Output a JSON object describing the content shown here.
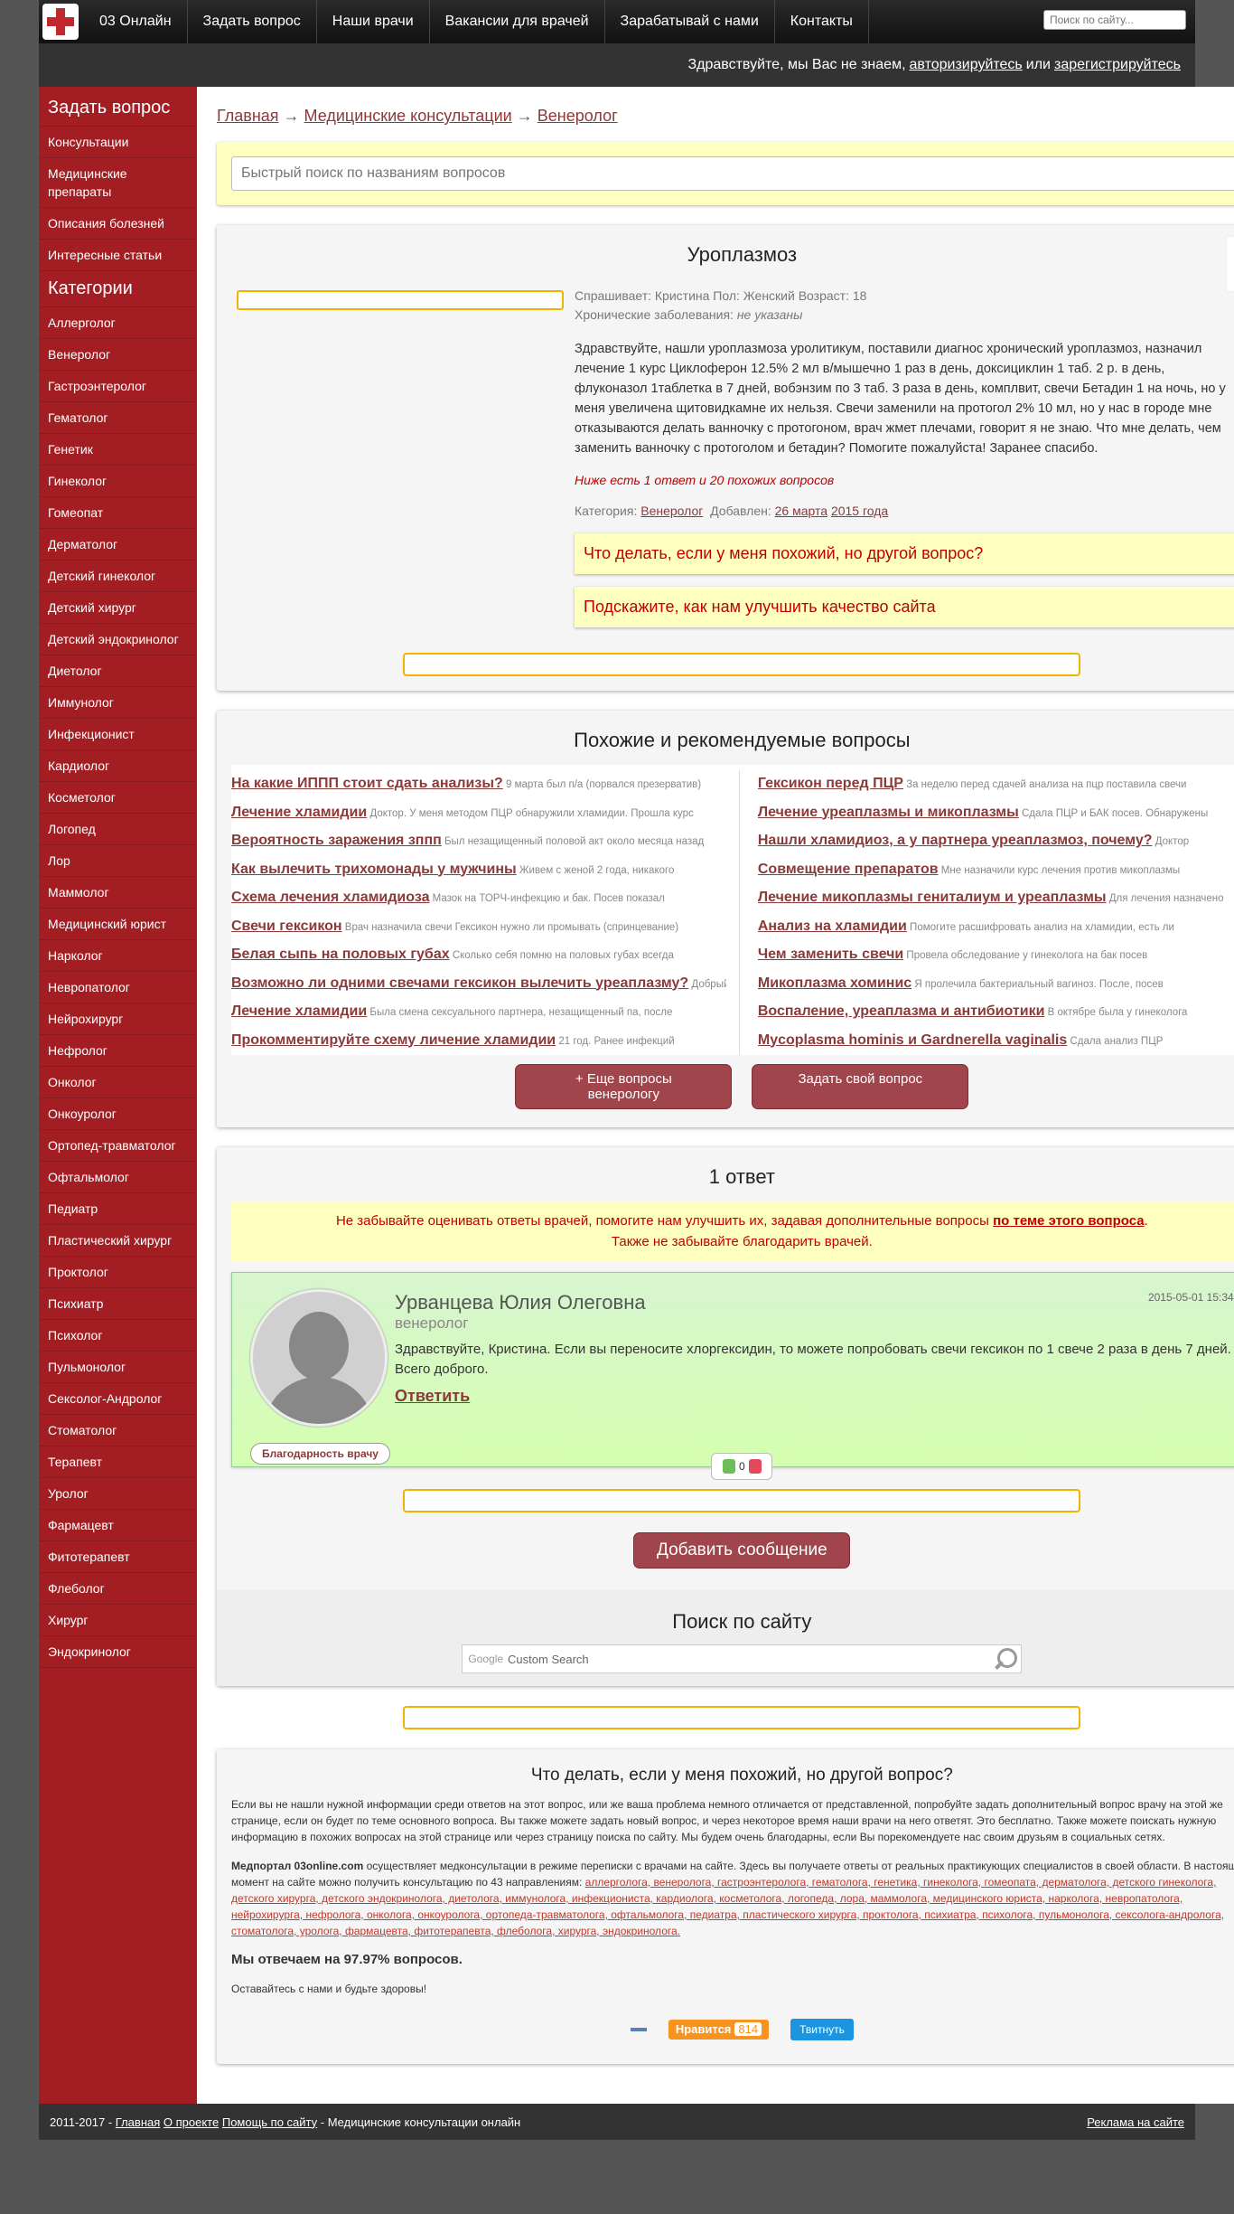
{
  "topnav": {
    "items": [
      "03 Онлайн",
      "Задать вопрос",
      "Наши врачи",
      "Вакансии для врачей",
      "Зарабатывай с нами",
      "Контакты"
    ],
    "search_placeholder": "Поиск по сайту..."
  },
  "greeting": {
    "text": "Здравствуйте, мы Вас не знаем,",
    "login": "авторизируйтесь",
    "or": "или",
    "register": "зарегистрируйтесь"
  },
  "sidebar": {
    "ask_heading": "Задать вопрос",
    "ask_items": [
      "Консультации",
      "Медицинские препараты",
      "Описания болезней",
      "Интересные статьи"
    ],
    "cat_heading": "Категории",
    "categories": [
      "Аллерголог",
      "Венеролог",
      "Гастроэнтеролог",
      "Гематолог",
      "Генетик",
      "Гинеколог",
      "Гомеопат",
      "Дерматолог",
      "Детский гинеколог",
      "Детский хирург",
      "Детский эндокринолог",
      "Диетолог",
      "Иммунолог",
      "Инфекционист",
      "Кардиолог",
      "Косметолог",
      "Логопед",
      "Лор",
      "Маммолог",
      "Медицинский юрист",
      "Нарколог",
      "Невропатолог",
      "Нейрохирург",
      "Нефролог",
      "Онколог",
      "Онкоуролог",
      "Ортопед-травматолог",
      "Офтальмолог",
      "Педиатр",
      "Пластический хирург",
      "Проктолог",
      "Психиатр",
      "Психолог",
      "Пульмонолог",
      "Сексолог-Андролог",
      "Стоматолог",
      "Терапевт",
      "Уролог",
      "Фармацевт",
      "Фитотерапевт",
      "Флеболог",
      "Хирург",
      "Эндокринолог"
    ]
  },
  "breadcrumbs": {
    "home": "Главная",
    "arrow": "→",
    "consult": "Медицинские консультации",
    "current": "Венеролог"
  },
  "quick_search": {
    "placeholder": "Быстрый поиск по названиям вопросов"
  },
  "question": {
    "title": "Уроплазмоз",
    "asker_line": "Спрашивает: Кристина   Пол: Женский   Возраст: 18",
    "chronic_label": "Хронические заболевания:",
    "chronic_value": "не указаны",
    "text": "Здравствуйте, нашли уроплазмоза уролитикум, поставили диагнос хронический уроплазмоз, назначил лечение 1 курс Циклоферон 12.5% 2 мл в/мышечно 1 раз в день, доксициклин 1 таб. 2 р. в день, флуконазол 1таблетка в 7 дней, вобэнзим по 3 таб. 3 раза в день, комплвит, свечи Бетадин 1 на ночь, но у меня увеличена щитовидкамне их нельзя. Свечи заменили на протогол 2% 10 мл, но у нас в городе мне отказываются делать ванночку с протогоном, врач жмет плечами, говорит я не знаю. Что мне делать, чем заменить ванночку с протоголом и бетадин? Помогите пожалуйста! Заранее спасибо.",
    "below_note": "Ниже есть 1 ответ и 20 похожих вопросов",
    "category_label": "Категория:",
    "category": "Венеролог",
    "added_label": "Добавлен:",
    "added_day": "26 марта",
    "added_year": "2015 года",
    "link1": "Что делать, если у меня похожий, но другой вопрос?",
    "link2": "Подскажите, как нам улучшить качество сайта",
    "votes": "0"
  },
  "similar": {
    "title": "Похожие и рекомендуемые вопросы",
    "left": [
      {
        "t": "На какие ИППП стоит сдать анализы?",
        "s": "9 марта был п/а (порвался презерватив)"
      },
      {
        "t": "Лечение хламидии",
        "s": "Доктор. У меня методом ПЦР обнаружили хламидии. Прошла курс"
      },
      {
        "t": "Вероятность заражения зппп",
        "s": "Был незащищенный половой акт около месяца назад"
      },
      {
        "t": "Как вылечить трихомонады у мужчины",
        "s": "Живем с женой 2 года, никакого"
      },
      {
        "t": "Схема лечения хламидиоза",
        "s": "Мазок на ТОРЧ-инфекцию и бак. Посев показал"
      },
      {
        "t": "Свечи гексикон",
        "s": "Врач назначила свечи Гексикон нужно ли промывать (спринцевание)"
      },
      {
        "t": "Белая сыпь на половых губах",
        "s": "Сколько себя помню на половых губах всегда"
      },
      {
        "t": "Возможно ли одними свечами гексикон вылечить уреаплазму?",
        "s": "Добрый день"
      },
      {
        "t": "Лечение хламидии",
        "s": "Была смена сексуального партнера, незащищенный па, после"
      },
      {
        "t": "Прокомментируйте схему личение хламидии",
        "s": "21 год. Ранее инфекций"
      }
    ],
    "right": [
      {
        "t": "Гексикон перед ПЦР",
        "s": "За неделю перед сдачей анализа на пцр поставила свечи"
      },
      {
        "t": "Лечение уреаплазмы и микоплазмы",
        "s": "Сдала ПЦР и БАК посев. Обнаружены"
      },
      {
        "t": "Нашли хламидиоз, а у партнера уреаплазмоз, почему?",
        "s": "Доктор"
      },
      {
        "t": "Совмещение препаратов",
        "s": "Мне назначили курс лечения против микоплазмы"
      },
      {
        "t": "Лечение микоплазмы гениталиум и уреаплазмы",
        "s": "Для лечения назначено"
      },
      {
        "t": "Анализ на хламидии",
        "s": "Помогите расшифровать анализ на хламидии, есть ли"
      },
      {
        "t": "Чем заменить свечи",
        "s": "Провела обследование у гинеколога на бак посев"
      },
      {
        "t": "Микоплазма хоминис",
        "s": "Я пролечила бактериальный вагиноз. После, посев"
      },
      {
        "t": "Воспаление, уреаплазма и антибиотики",
        "s": "В октябре была у гинеколога"
      },
      {
        "t": "Mycoplasma hominis и Gardnerella vaginalis",
        "s": "Сдала анализ ПЦР"
      }
    ],
    "more_btn": "+ Еще вопросы венерологу",
    "ask_btn": "Задать свой вопрос"
  },
  "answers": {
    "title": "1 ответ",
    "notice_1": "Не забывайте оценивать ответы врачей, помогите нам улучшить их, задавая дополнительные вопросы",
    "notice_link": "по теме этого вопроса",
    "notice_2": "Также не забывайте благодарить врачей.",
    "doctor_name": "Урванцева Юлия Олеговна",
    "doctor_spec": "венеролог",
    "date": "2015-05-01 15:34",
    "text": "Здравствуйте, Кристина. Если вы переносите хлоргексидин, то можете попробовать свечи гексикон по 1 свече 2 раза в день 7 дней. Всего доброго.",
    "reply": "Ответить",
    "thanks": "Благодарность врачу",
    "likes": "0",
    "add_message": "Добавить сообщение"
  },
  "site_search": {
    "title": "Поиск по сайту",
    "google": "Google",
    "custom": "Custom Search"
  },
  "info": {
    "title": "Что делать, если у меня похожий, но другой вопрос?",
    "p1": "Если вы не нашли нужной информации среди ответов на этот вопрос, или же ваша проблема немного отличается от представленной, попробуйте задать дополнительный вопрос врачу на этой же странице, если он будет по теме основного вопроса. Вы также можете задать новый вопрос, и через некоторое время наши врачи на него ответят. Это бесплатно. Также можете поискать нужную информацию в похожих вопросах на этой странице или через страницу поиска по сайту. Мы будем очень благодарны, если Вы порекомендуете нас своим друзьям в социальных сетях.",
    "p2_lead": "Медпортал 03online.com",
    "p2_text": "осуществляет медконсультации в режиме переписки с врачами на сайте. Здесь вы получаете ответы от реальных практикующих специалистов в своей области. В настоящий момент на сайте можно получить консультацию по 43 направлениям:",
    "specs": "аллерголога, венеролога, гастроэнтеролога, гематолога, генетика, гинеколога, гомеопата, дерматолога, детского гинеколога, детского хирурга, детского эндокринолога, диетолога, иммунолога, инфекциониста, кардиолога, косметолога, логопеда, лора, маммолога, медицинского юриста, нарколога, невропатолога, нейрохирурга, нефролога, онколога, онкоуролога, ортопеда-травматолога, офтальмолога, педиатра, пластического хирурга, проктолога, психиатра, психолога, пульмонолога, сексолога-андролога, стоматолога, уролога, фармацевта, фитотерапевта, флеболога, хирурга, эндокринолога.",
    "p3": "Мы отвечаем на 97.97% вопросов.",
    "p4": "Оставайтесь с нами и будьте здоровы!",
    "ok_label": "Нравится",
    "ok_count": "814",
    "tw_label": "Твитнуть"
  },
  "footer": {
    "years": "2011-2017 -",
    "home": "Главная",
    "about": "О проекте",
    "help": "Помощь по сайту",
    "tail": "- Медицинские консультации онлайн",
    "ads": "Реклама на сайте"
  }
}
